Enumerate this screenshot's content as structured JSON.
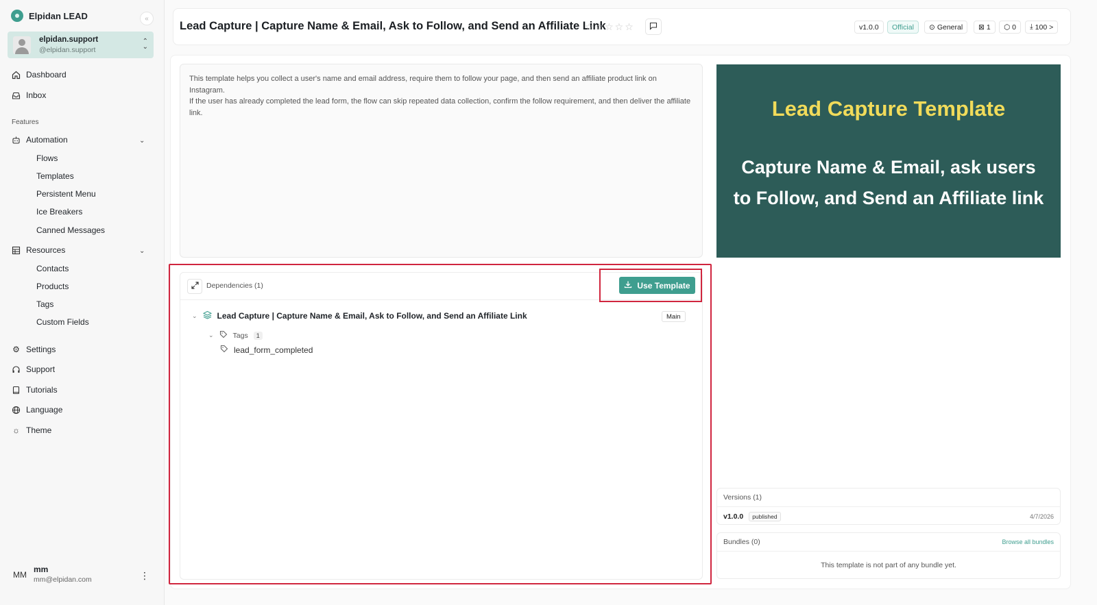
{
  "sidebar": {
    "brand": "Elpidan LEAD",
    "collapse_icon": "«",
    "account": {
      "name": "elpidan.support",
      "handle": "@elpidan.support"
    },
    "nav_top": [
      {
        "label": "Dashboard",
        "icon": "home-icon"
      },
      {
        "label": "Inbox",
        "icon": "inbox-icon"
      }
    ],
    "features_label": "Features",
    "automation": {
      "label": "Automation",
      "items": [
        "Flows",
        "Templates",
        "Persistent Menu",
        "Ice Breakers",
        "Canned Messages"
      ]
    },
    "resources": {
      "label": "Resources",
      "items": [
        "Contacts",
        "Products",
        "Tags",
        "Custom Fields"
      ]
    },
    "nav_bottom": [
      {
        "label": "Settings",
        "icon": "gear-icon"
      },
      {
        "label": "Support",
        "icon": "headset-icon"
      },
      {
        "label": "Tutorials",
        "icon": "book-icon"
      },
      {
        "label": "Language",
        "icon": "globe-icon"
      },
      {
        "label": "Theme",
        "icon": "sun-icon"
      }
    ],
    "user": {
      "initials": "MM",
      "name": "mm",
      "email": "mm@elpidan.com"
    }
  },
  "header": {
    "title": "Lead Capture | Capture Name & Email, Ask to Follow, and Send an Affiliate Link",
    "version": "v1.0.0",
    "official": "Official",
    "category": "General",
    "flows_count": "1",
    "deps_count": "0",
    "downloads": "100 >"
  },
  "description": {
    "p1": "This template helps you collect a user's name and email address, require them to follow your page, and then send an affiliate product link on Instagram.",
    "p2": "If the user has already completed the lead form, the flow can skip repeated data collection, confirm the follow requirement, and then deliver the affiliate link."
  },
  "hero": {
    "title": "Lead Capture Template",
    "subtitle": "Capture Name & Email, ask users to Follow, and Send an Affiliate link",
    "colors": {
      "background": "#2d5c58",
      "title": "#f1db5a"
    }
  },
  "dependencies": {
    "title": "Dependencies (1)",
    "use_button": "Use Template",
    "main_item": "Lead Capture | Capture Name & Email, Ask to Follow, and Send an Affiliate Link",
    "main_badge": "Main",
    "tags_label": "Tags",
    "tags_count": "1",
    "tag_value": "lead_form_completed"
  },
  "versions": {
    "title": "Versions (1)",
    "version": "v1.0.0",
    "status": "published",
    "date": "4/7/2026"
  },
  "bundles": {
    "title": "Bundles (0)",
    "link": "Browse all bundles",
    "empty": "This template is not part of any bundle yet."
  },
  "accent": "#3f9e8f",
  "highlight": "#d0253e"
}
